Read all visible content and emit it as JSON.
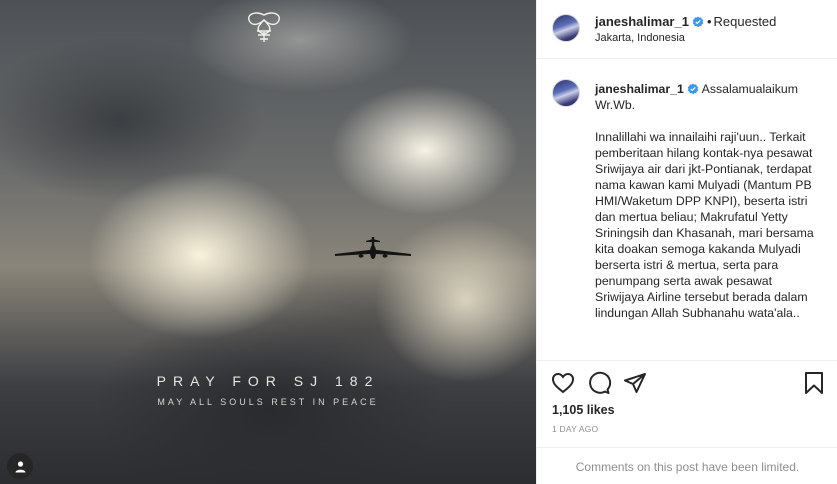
{
  "post": {
    "image": {
      "title": "PRAY FOR SJ 182",
      "subtitle": "MAY ALL SOULS REST IN PEACE",
      "logo_icon": "ornament-knot-icon",
      "plane_icon": "airplane-silhouette-icon",
      "tag_icon": "user-tag-icon"
    },
    "header": {
      "username": "janeshalimar_1",
      "verified_icon": "verified-badge-icon",
      "separator": "•",
      "follow_status": "Requested",
      "location": "Jakarta, Indonesia"
    },
    "caption": {
      "username": "janeshalimar_1",
      "greeting": "Assalamualaikum Wr.Wb.",
      "body": "Innalillahi wa innailaihi raji'uun.. Terkait pemberitaan hilang kontak-nya pesawat Sriwijaya air dari jkt-Pontianak, terdapat nama kawan kami Mulyadi (Mantum PB HMI/Waketum DPP KNPI), beserta istri dan mertua beliau; Makrufatul Yetty Sriningsih dan Khasanah, mari bersama kita doakan semoga kakanda Mulyadi berserta istri & mertua, serta para penumpang serta awak pesawat Sriwijaya Airline tersebut berada dalam lindungan Allah Subhanahu wata'ala.."
    },
    "actions": {
      "like_icon": "heart-icon",
      "comment_icon": "comment-bubble-icon",
      "share_icon": "paper-plane-icon",
      "save_icon": "bookmark-icon"
    },
    "likes": "1,105 likes",
    "timestamp": "1 DAY AGO",
    "comments_limited": "Comments on this post have been limited.",
    "colors": {
      "verified_blue": "#3897f0",
      "text": "#262626",
      "muted": "#8e8e8e",
      "divider": "#efefef"
    }
  }
}
